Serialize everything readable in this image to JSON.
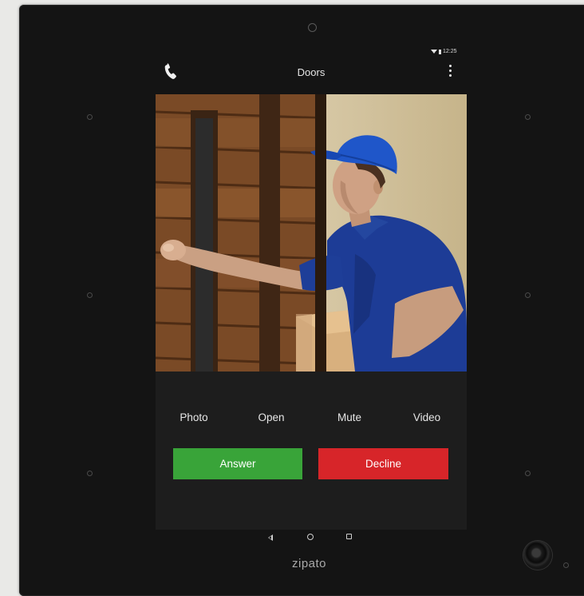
{
  "status_bar": {
    "time": "12:25"
  },
  "header": {
    "title": "Doors",
    "left_icon": "phone-icon",
    "right_icon": "more-vertical-icon"
  },
  "video_feed": {
    "subject": "delivery-person-at-door"
  },
  "actions": [
    {
      "label": "Photo"
    },
    {
      "label": "Open"
    },
    {
      "label": "Mute"
    },
    {
      "label": "Video"
    }
  ],
  "call_buttons": {
    "answer_label": "Answer",
    "decline_label": "Decline",
    "answer_color": "#39a439",
    "decline_color": "#d72529"
  },
  "nav_bar": {
    "icons": [
      "back-icon",
      "home-icon",
      "recent-apps-icon"
    ]
  },
  "device": {
    "brand": "zipato"
  },
  "colors": {
    "bezel": "#141414",
    "panel": "#1d1d1d"
  }
}
